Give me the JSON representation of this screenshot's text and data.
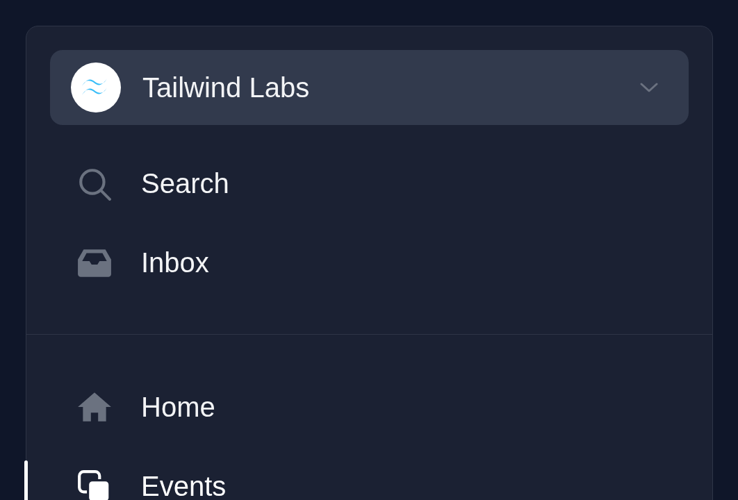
{
  "team_switcher": {
    "name": "Tailwind Labs"
  },
  "sidebar": {
    "sections": [
      {
        "items": [
          {
            "label": "Search",
            "selected": false
          },
          {
            "label": "Inbox",
            "selected": false
          }
        ]
      },
      {
        "items": [
          {
            "label": "Home",
            "selected": false
          },
          {
            "label": "Events",
            "selected": true
          }
        ]
      }
    ]
  }
}
